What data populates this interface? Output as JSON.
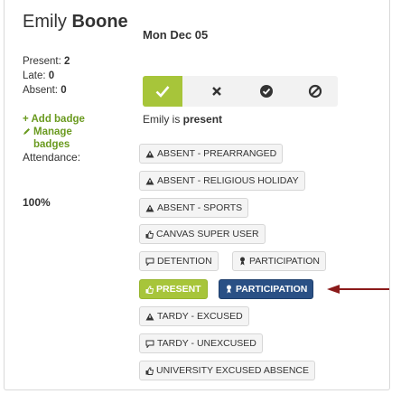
{
  "student": {
    "first_name": "Emily",
    "last_name": "Boone"
  },
  "stats": {
    "present_label": "Present:",
    "present_value": "2",
    "late_label": "Late:",
    "late_value": "0",
    "absent_label": "Absent:",
    "absent_value": "0"
  },
  "links": {
    "add_badge": "+ Add badge",
    "manage_badges": "Manage badges"
  },
  "attendance": {
    "label": "Attendance:",
    "value": "100%"
  },
  "day": {
    "date": "Mon Dec 05"
  },
  "status": {
    "prefix": "Emily is ",
    "value": "present"
  },
  "icons": {
    "present": "check-icon",
    "absent": "x-icon",
    "late": "clock-check-icon",
    "excused": "circle-slash-icon",
    "warning": "warning-icon",
    "thumbs": "thumbs-up-icon",
    "comment": "comment-icon",
    "person": "person-icon"
  },
  "colors": {
    "present_green": "#a7c53a",
    "selected_blue": "#2a5085",
    "arrow": "#8b1a1a"
  },
  "badges": [
    {
      "label": "ABSENT - PREARRANGED"
    },
    {
      "label": "ABSENT - RELIGIOUS HOLIDAY"
    },
    {
      "label": "ABSENT - SPORTS"
    },
    {
      "label": "CANVAS SUPER USER"
    },
    {
      "label": "DETENTION"
    },
    {
      "label": "PARTICIPATION"
    },
    {
      "label": "PRESENT",
      "selected": true
    },
    {
      "label": "PARTICIPATION",
      "selected": true
    },
    {
      "label": "TARDY - EXCUSED"
    },
    {
      "label": "TARDY - UNEXCUSED"
    },
    {
      "label": "UNIVERSITY EXCUSED ABSENCE"
    }
  ]
}
